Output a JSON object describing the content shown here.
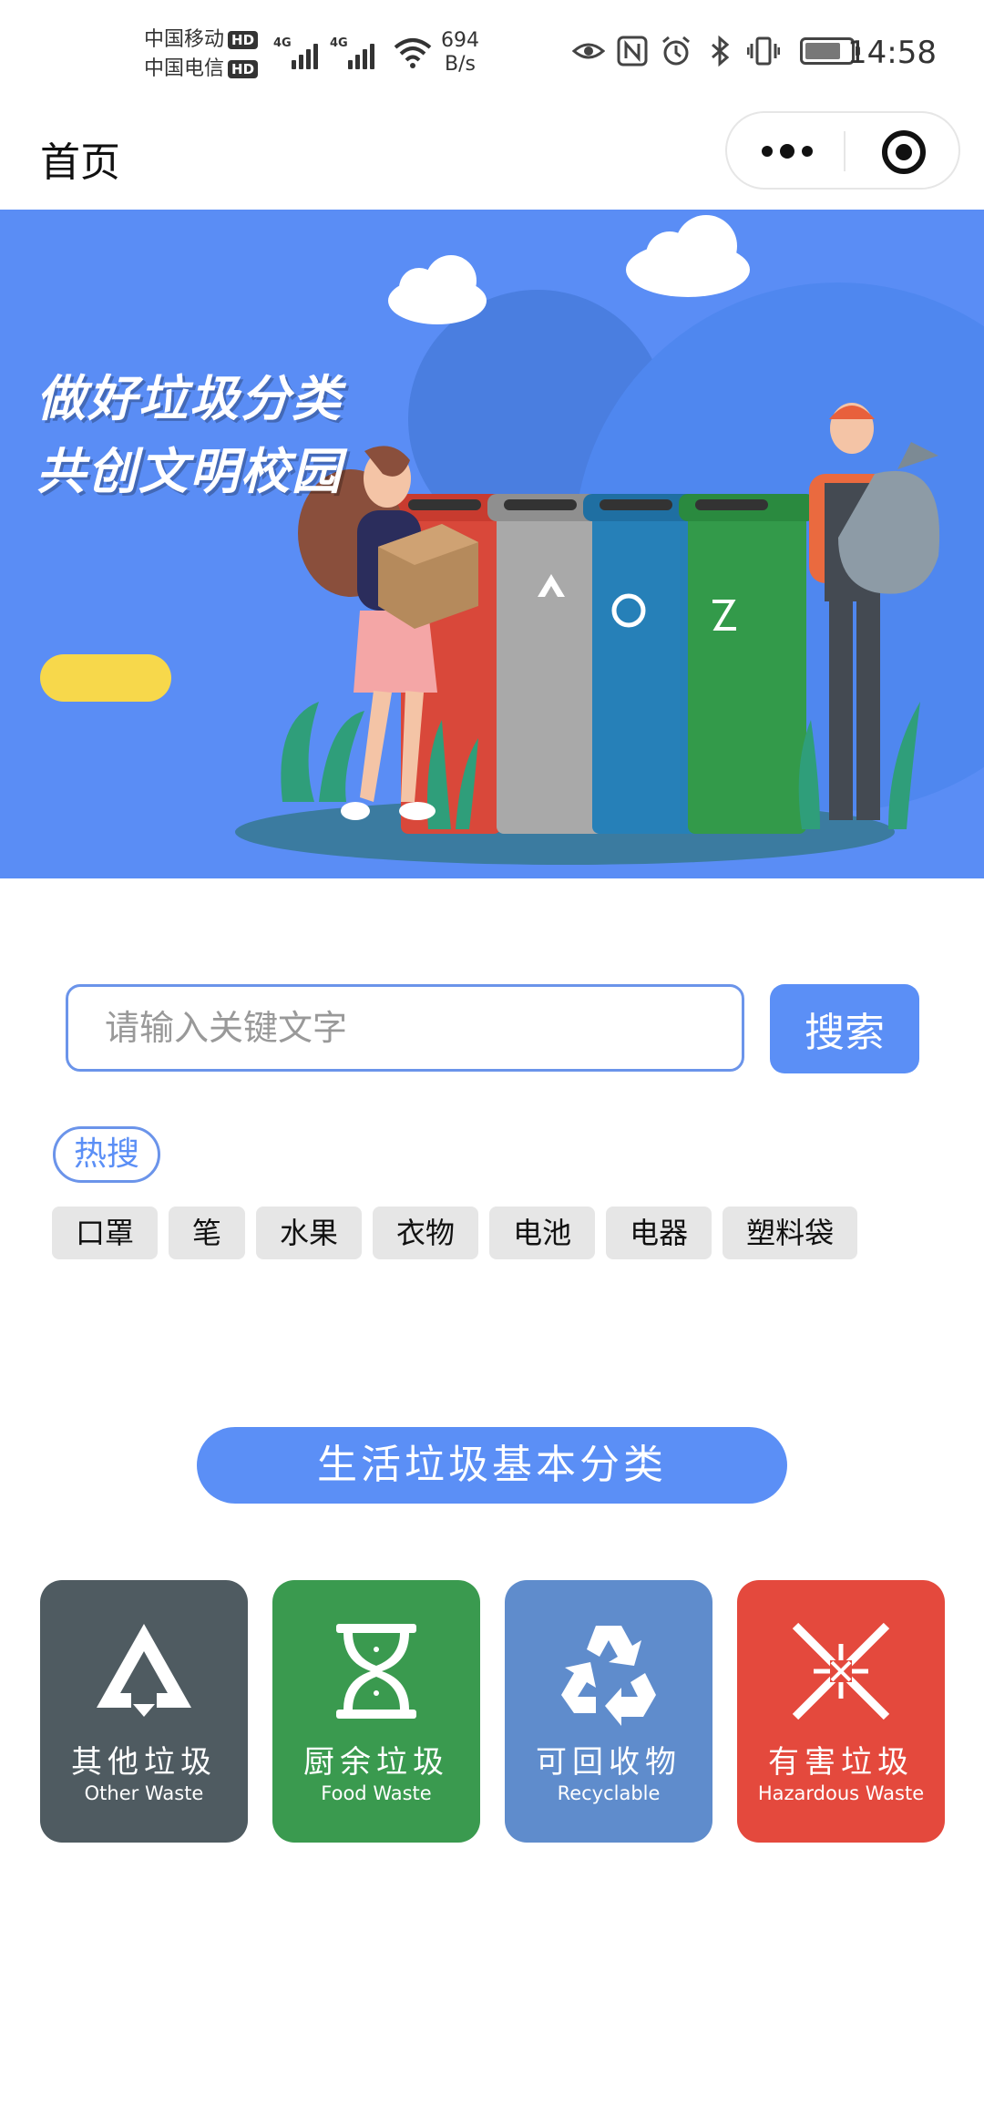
{
  "status_bar": {
    "carrier1": "中国移动",
    "carrier2": "中国电信",
    "hd": "HD",
    "network": "4G",
    "speed_value": "694",
    "speed_unit": "B/s",
    "time": "14:58",
    "icons": [
      "eye-icon",
      "nfc-icon",
      "alarm-icon",
      "bluetooth-icon",
      "vibrate-icon",
      "battery-icon"
    ]
  },
  "nav": {
    "title": "首页"
  },
  "banner": {
    "slogan_line1": "做好垃圾分类",
    "slogan_line2": "共创文明校园"
  },
  "search": {
    "placeholder": "请输入关键文字",
    "button_label": "搜索"
  },
  "hot": {
    "label": "热搜",
    "tags": [
      "口罩",
      "笔",
      "水果",
      "衣物",
      "电池",
      "电器",
      "塑料袋"
    ]
  },
  "categories": {
    "title": "生活垃圾基本分类",
    "items": [
      {
        "cn": "其他垃圾",
        "en": "Other Waste",
        "color": "#4f5b61",
        "icon": "other-waste-icon"
      },
      {
        "cn": "厨余垃圾",
        "en": "Food Waste",
        "color": "#3a9a4f",
        "icon": "food-waste-icon"
      },
      {
        "cn": "可回收物",
        "en": "Recyclable",
        "color": "#5f8ccc",
        "icon": "recycle-icon"
      },
      {
        "cn": "有害垃圾",
        "en": "Hazardous Waste",
        "color": "#e4493d",
        "icon": "hazardous-icon"
      }
    ]
  }
}
